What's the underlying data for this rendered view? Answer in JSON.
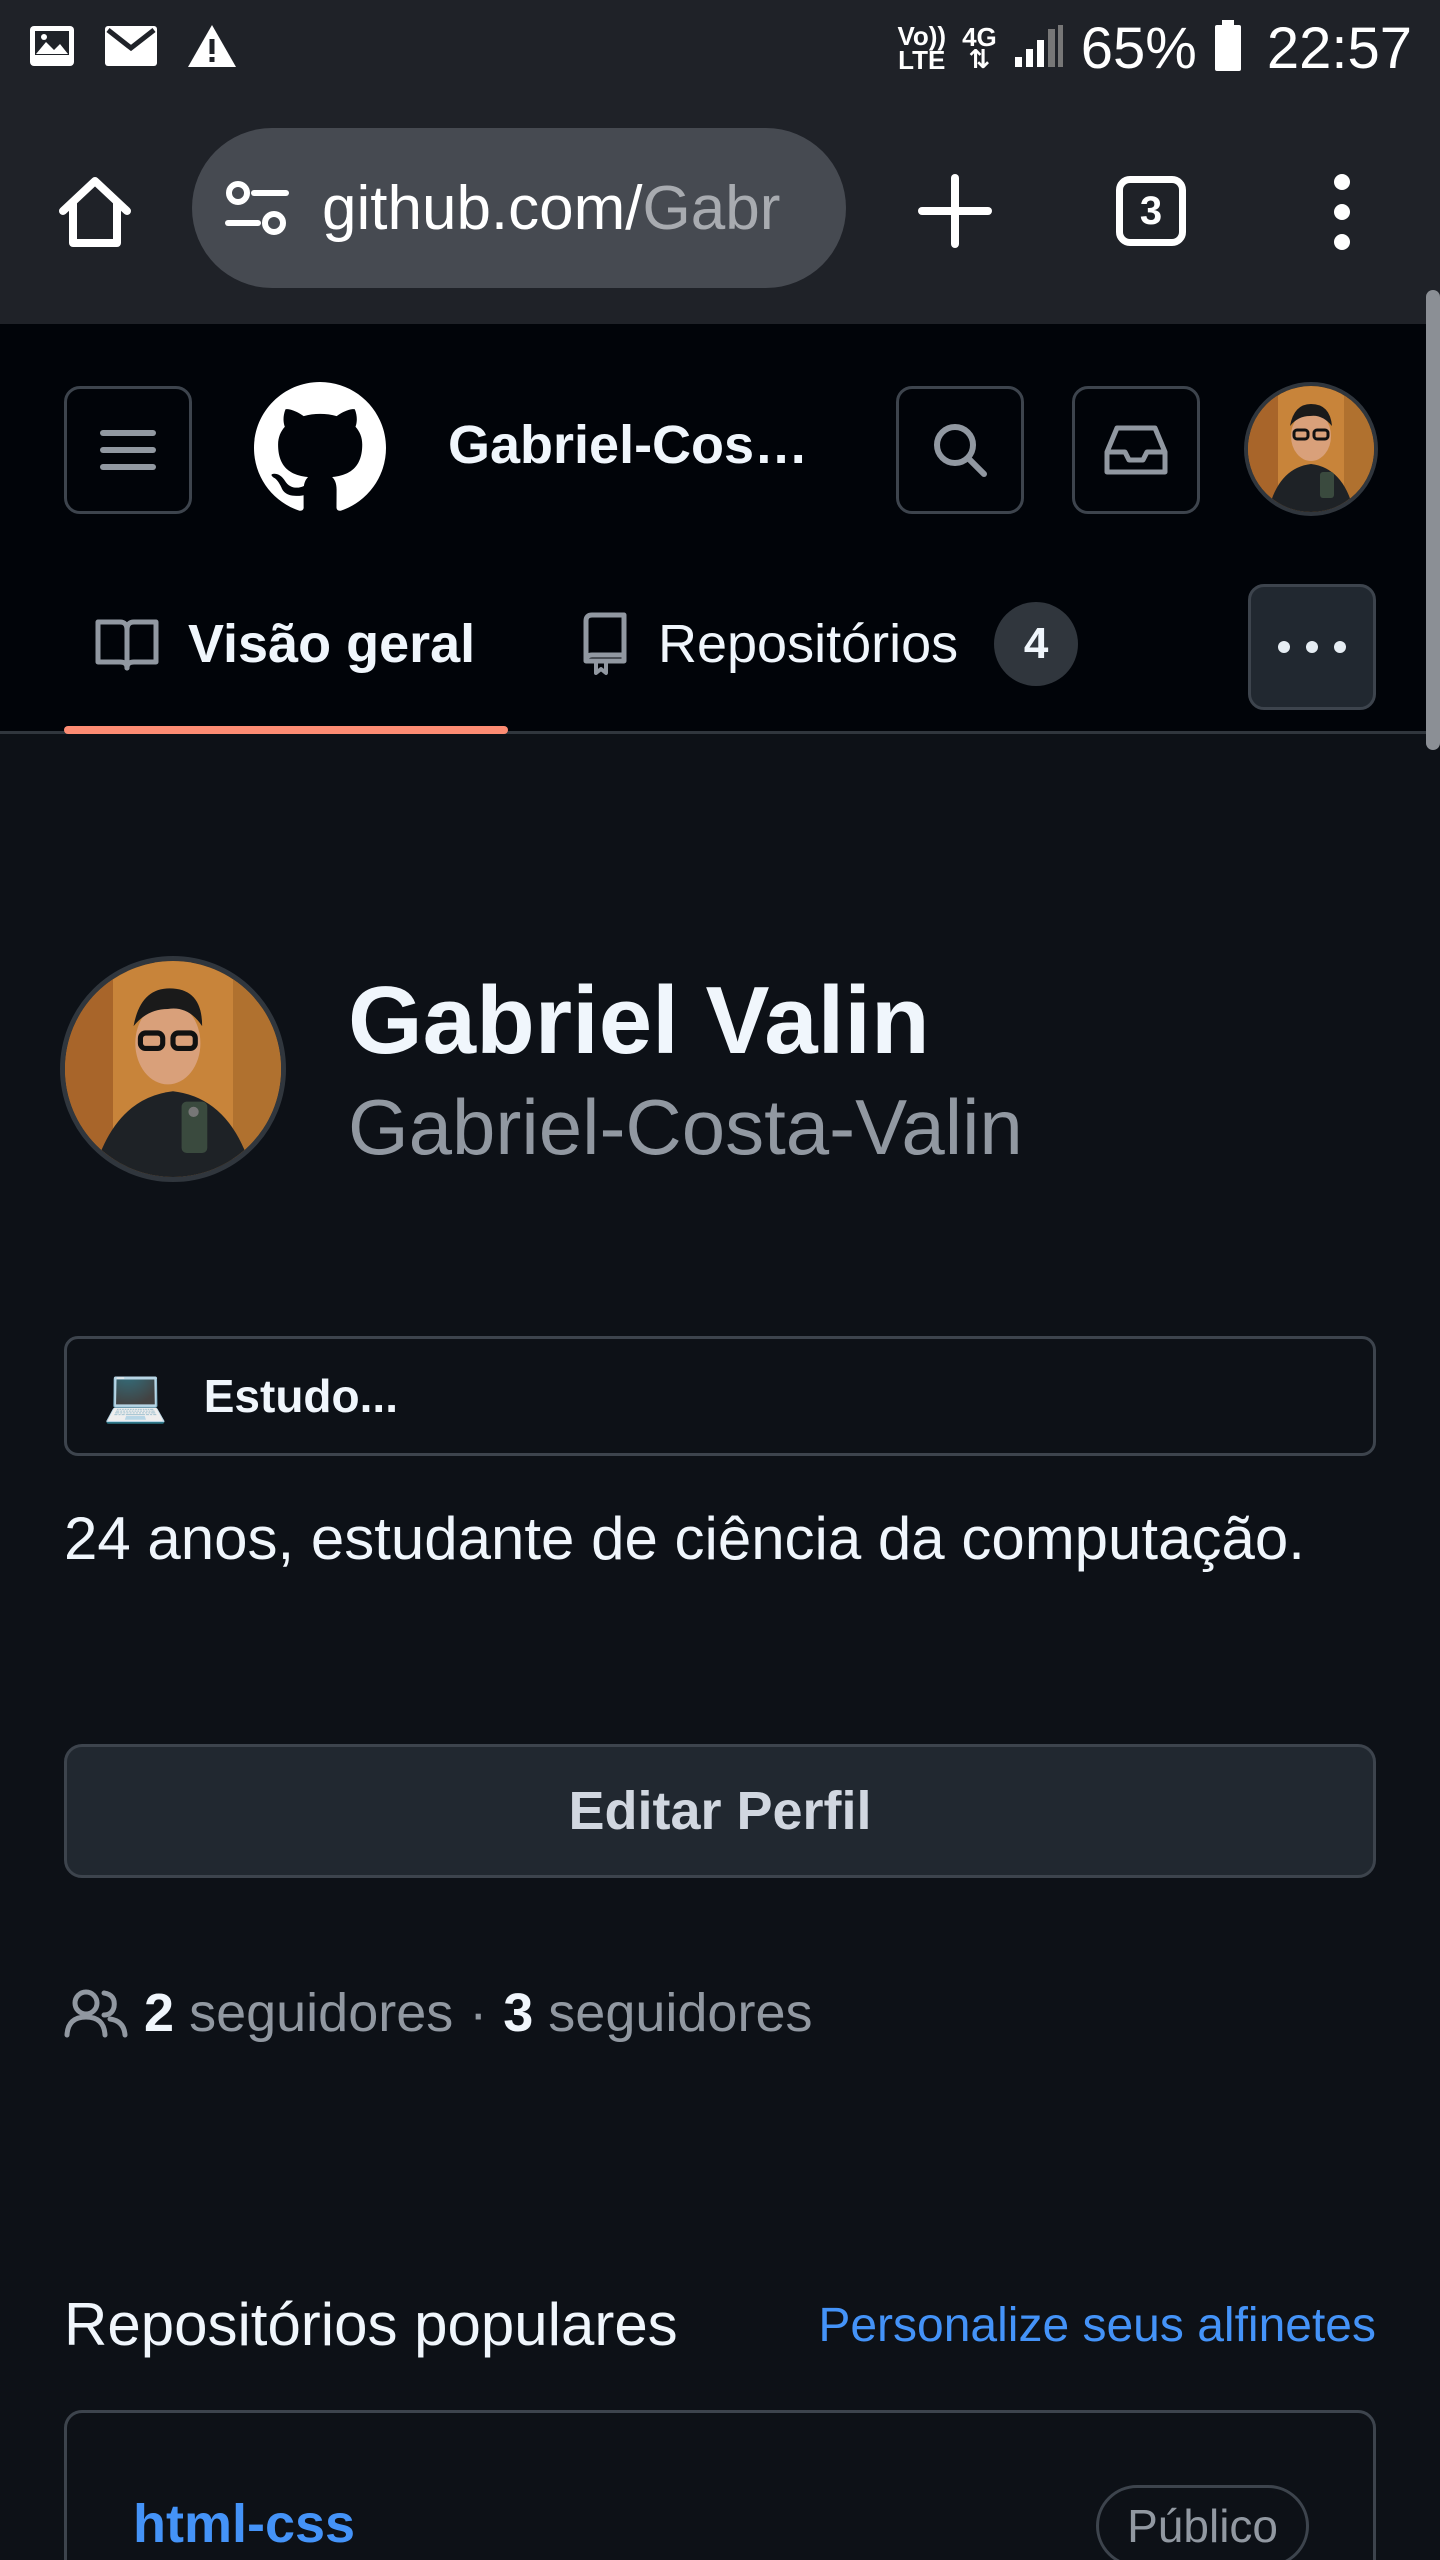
{
  "status_bar": {
    "notification_icons": [
      "image-icon",
      "mail-icon",
      "warning-icon"
    ],
    "network_top": "Vo))",
    "network_bottom": "LTE",
    "data_type": "4G",
    "battery_percent": "65%",
    "time": "22:57"
  },
  "browser": {
    "url_host": "github.com/",
    "url_path": "Gabr",
    "tab_count": "3"
  },
  "github_header": {
    "context_title": "Gabriel-Costa-Valin",
    "tabs": [
      {
        "label": "Visão geral",
        "icon": "book-icon",
        "selected": true
      },
      {
        "label": "Repositórios",
        "icon": "repo-icon",
        "count": "4"
      }
    ]
  },
  "profile": {
    "name": "Gabriel Valin",
    "login": "Gabriel-Costa-Valin",
    "status_emoji": "💻",
    "status_text": "Estudo...",
    "bio": "24 anos, estudante de ciência da computação.",
    "edit_button": "Editar Perfil",
    "followers_count": "2",
    "followers_label": "seguidores",
    "separator": "·",
    "following_count": "3",
    "following_label": "seguidores"
  },
  "popular": {
    "title": "Repositórios populares",
    "customize_link": "Personalize seus alfinetes",
    "repos": [
      {
        "name": "html-css",
        "visibility": "Público"
      }
    ]
  },
  "colors": {
    "background": "#0d1117",
    "header_bg": "#010409",
    "accent_link": "#4493f8",
    "tab_underline": "#fd8c73",
    "chrome_bg": "#1f2228"
  }
}
